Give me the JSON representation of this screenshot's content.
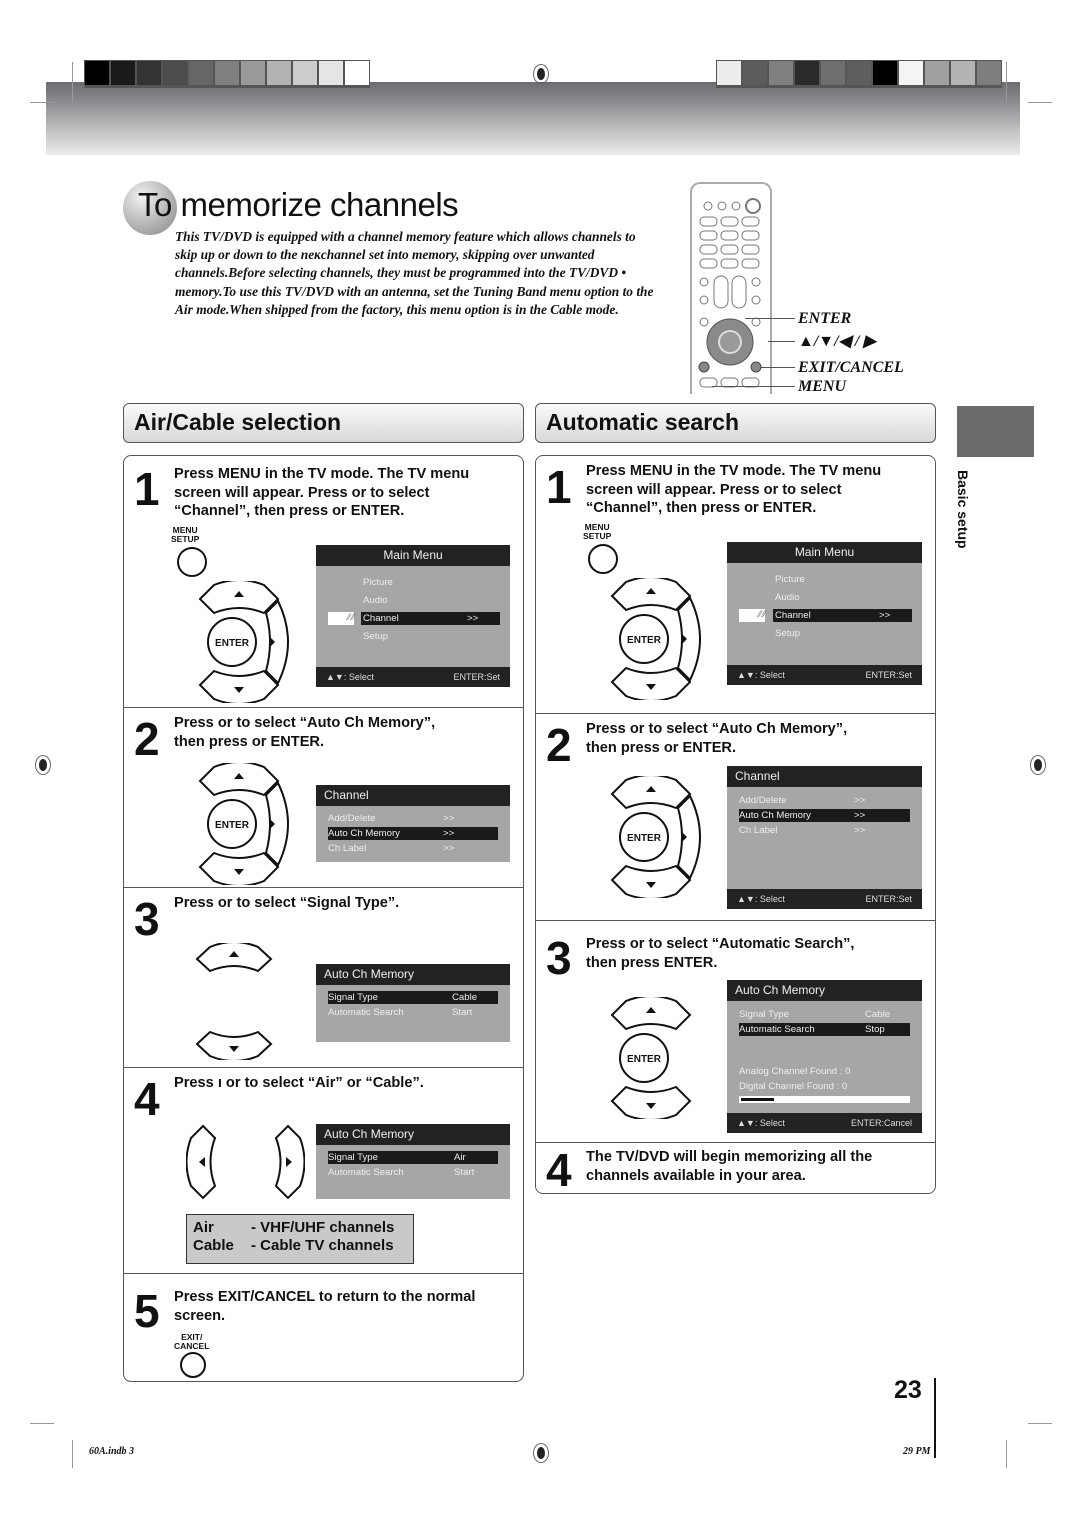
{
  "header": {
    "swatches_left": [
      "#000000",
      "#1a1a1a",
      "#333333",
      "#4d4d4d",
      "#666666",
      "#808080",
      "#999999",
      "#b3b3b3",
      "#cccccc",
      "#e6e6e6",
      "#ffffff"
    ],
    "swatches_right": [
      "#ececec",
      "#5c5c5c",
      "#808080",
      "#2a2a2a",
      "#6e6e6e",
      "#5e5e5e",
      "#000000",
      "#f4f4f4",
      "#a0a0a0",
      "#b4b4b4",
      "#7e7e7e"
    ]
  },
  "title": {
    "prefix": "To",
    "rest": " memorize channels"
  },
  "intro": "This TV/DVD is equipped with a channel memory feature which allows channels to skip up or down to the neĸchannel set into memory, skipping over unwanted channels.Before selecting channels, they must be programmed into the TV/DVD • memory.To use this TV/DVD with an antenna, set the Tuning Band menu option to the Air mode.When shipped from the factory, this menu option is in the Cable mode.",
  "remote": {
    "labels": [
      "ENTER",
      "▲/▼/◀ / ▶",
      "EXIT/CANCEL",
      "MENU"
    ]
  },
  "side_tab": {
    "label": "Basic setup"
  },
  "page_number": "23",
  "footer": {
    "left": "60A.indb  3",
    "right": "29 PM"
  },
  "sections": {
    "air_cable": {
      "title": "Air/Cable selection",
      "steps": [
        {
          "num": "1",
          "lines": [
            "Press MENU in the TV mode. The TV menu",
            "screen will appear. Press    or     to select",
            "“Channel”, then press    or ENTER."
          ],
          "button_label": [
            "MENU",
            "SETUP"
          ],
          "osd": {
            "title": "Main Menu",
            "items": [
              "Picture",
              "Audio",
              "Channel",
              "Setup"
            ],
            "selected": "Channel",
            "arrow": ">>",
            "foot_left": "▲▼: Select",
            "foot_right": "ENTER:Set"
          }
        },
        {
          "num": "2",
          "lines": [
            "Press    or     to select “Auto Ch Memory”,",
            "then press    or ENTER."
          ],
          "osd": {
            "title": "Channel",
            "items": [
              {
                "label": "Add/Delete",
                "value": ">>"
              },
              {
                "label": "Auto Ch Memory",
                "value": ">>"
              },
              {
                "label": "Ch Label",
                "value": ">>"
              }
            ],
            "selected": "Auto Ch Memory"
          }
        },
        {
          "num": "3",
          "lines": [
            "Press    or     to select “Signal Type”."
          ],
          "osd": {
            "title": "Auto Ch Memory",
            "items": [
              {
                "label": "Signal Type",
                "value": "Cable"
              },
              {
                "label": "Automatic Search",
                "value": "Start"
              }
            ],
            "selected": "Signal Type"
          }
        },
        {
          "num": "4",
          "lines": [
            "Press  ı or     to select “Air” or “Cable”."
          ],
          "osd": {
            "title": "Auto Ch Memory",
            "items": [
              {
                "label": "Signal Type",
                "value": "Air"
              },
              {
                "label": "Automatic Search",
                "value": "Start"
              }
            ],
            "selected": "Signal Type"
          },
          "legend": [
            {
              "term": "Air",
              "desc": "- VHF/UHF channels"
            },
            {
              "term": "Cable",
              "desc": "- Cable TV channels"
            }
          ]
        },
        {
          "num": "5",
          "lines": [
            "Press EXIT/CANCEL to return to the normal",
            "screen."
          ],
          "button_label": [
            "EXIT/",
            "CANCEL"
          ]
        }
      ]
    },
    "auto_search": {
      "title": "Automatic search",
      "steps": [
        {
          "num": "1",
          "lines": [
            "Press MENU in the TV mode. The TV menu",
            "screen will appear. Press    or     to select",
            "“Channel”, then press    or ENTER."
          ],
          "button_label": [
            "MENU",
            "SETUP"
          ],
          "osd": {
            "title": "Main Menu",
            "items": [
              "Picture",
              "Audio",
              "Channel",
              "Setup"
            ],
            "selected": "Channel",
            "arrow": ">>",
            "foot_left": "▲▼: Select",
            "foot_right": "ENTER:Set"
          }
        },
        {
          "num": "2",
          "lines": [
            "Press    or     to select “Auto Ch Memory”,",
            "then press    or ENTER."
          ],
          "osd": {
            "title": "Channel",
            "items": [
              {
                "label": "Add/Delete",
                "value": ">>"
              },
              {
                "label": "Auto Ch Memory",
                "value": ">>"
              },
              {
                "label": "Ch Label",
                "value": ">>"
              }
            ],
            "selected": "Auto Ch Memory",
            "foot_left": "▲▼: Select",
            "foot_right": "ENTER:Set"
          }
        },
        {
          "num": "3",
          "lines": [
            "Press    or     to select “Automatic Search”,",
            "then press ENTER."
          ],
          "osd": {
            "title": "Auto Ch Memory",
            "items": [
              {
                "label": "Signal Type",
                "value": "Cable"
              },
              {
                "label": "Automatic Search",
                "value": "Stop"
              }
            ],
            "selected": "Automatic Search",
            "analog_found": "Analog Channel Found : 0",
            "digital_found": "Digital Channel Found : 0",
            "progress_percent": 20,
            "foot_left": "▲▼: Select",
            "foot_right": "ENTER:Cancel"
          }
        },
        {
          "num": "4",
          "lines": [
            "The TV/DVD will begin memorizing all the",
            "channels available in your area."
          ]
        }
      ]
    }
  },
  "enter_label": "ENTER"
}
